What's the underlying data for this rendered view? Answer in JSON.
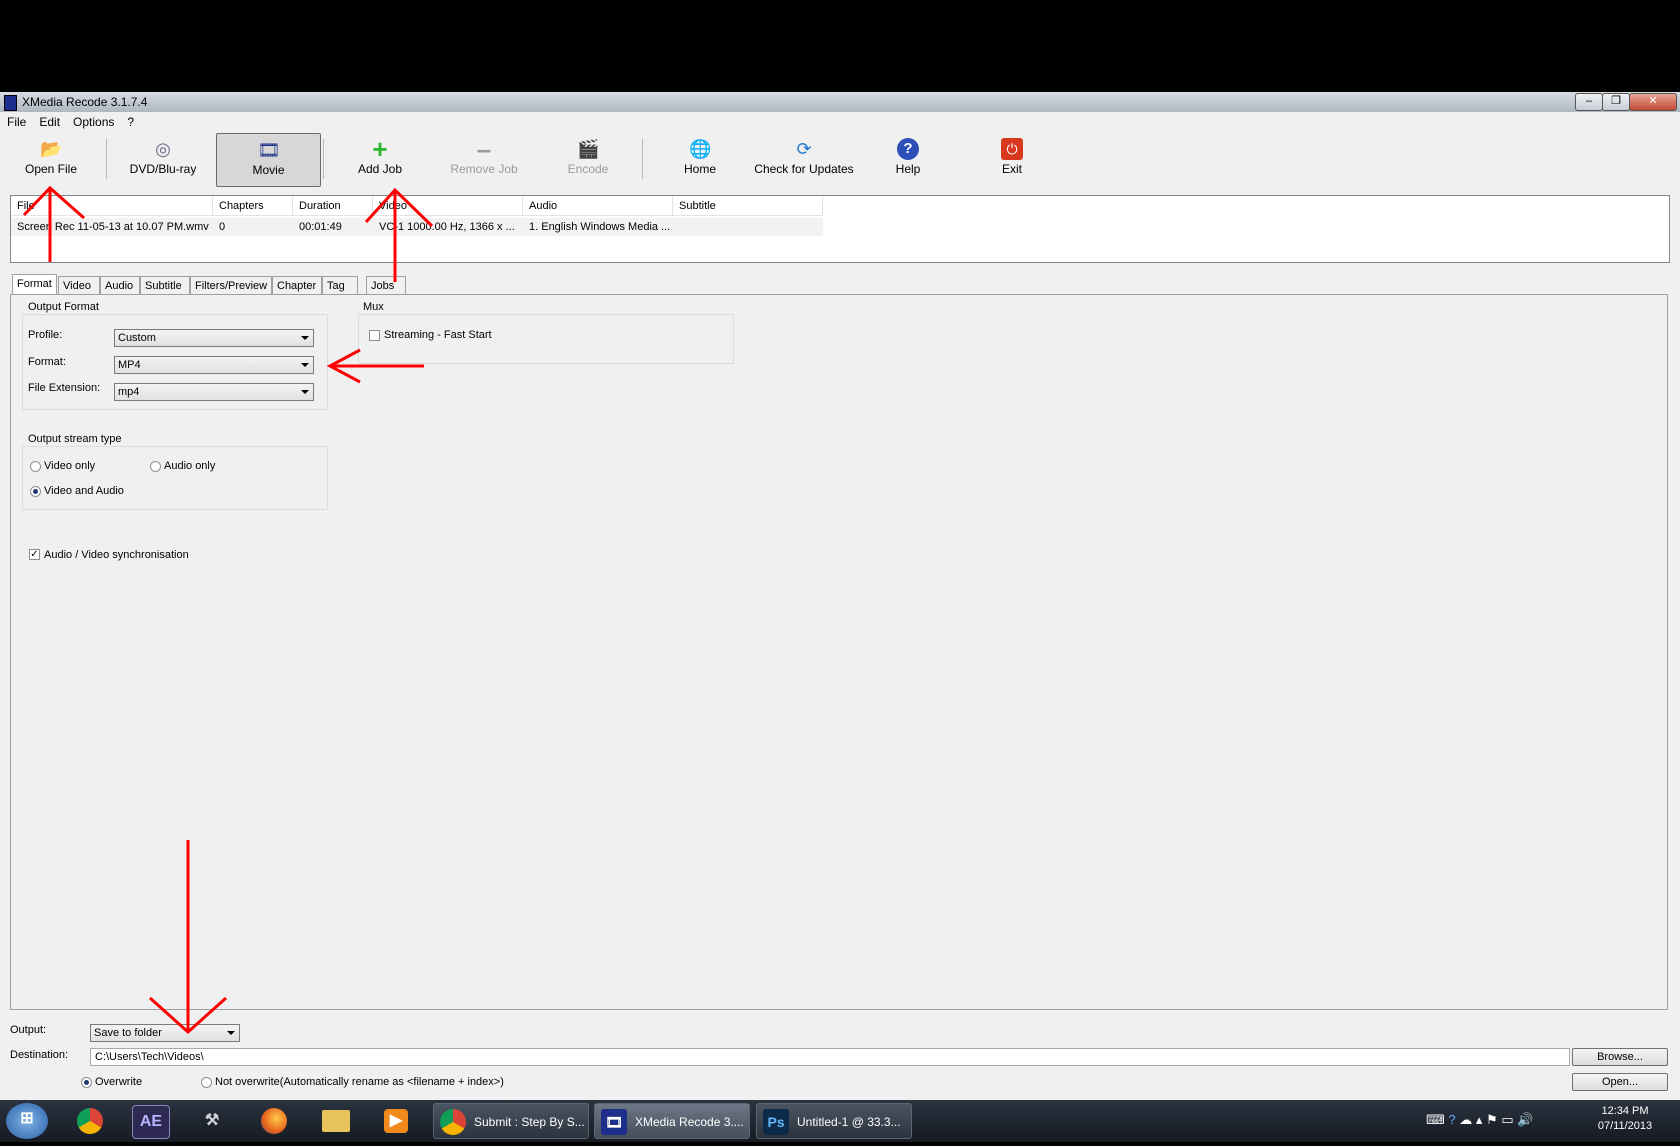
{
  "window": {
    "title": "XMedia Recode 3.1.7.4",
    "min": "0",
    "max": "1",
    "close": "r"
  },
  "menu": [
    "File",
    "Edit",
    "Options",
    "?"
  ],
  "toolbar": {
    "open_file": "Open File",
    "dvd": "DVD/Blu-ray",
    "movie": "Movie",
    "add_job": "Add Job",
    "remove_job": "Remove Job",
    "encode": "Encode",
    "home": "Home",
    "updates": "Check for Updates",
    "help": "Help",
    "exit": "Exit"
  },
  "filelist": {
    "columns": [
      "File",
      "Chapters",
      "Duration",
      "Video",
      "Audio",
      "Subtitle"
    ],
    "rows": [
      [
        "Screen Rec 11-05-13 at 10.07 PM.wmv",
        "0",
        "00:01:49",
        "VC-1 1000.00 Hz, 1366 x ...",
        "1. English Windows Media ...",
        ""
      ]
    ]
  },
  "tabs": [
    "Format",
    "Video",
    "Audio",
    "Subtitle",
    "Filters/Preview",
    "Chapter",
    "Tag",
    "Jobs"
  ],
  "format": {
    "output_format_title": "Output Format",
    "profile_label": "Profile:",
    "profile_value": "Custom",
    "format_label": "Format:",
    "format_value": "MP4",
    "ext_label": "File Extension:",
    "ext_value": "mp4",
    "mux_title": "Mux",
    "streaming_label": "Streaming - Fast Start",
    "stream_type_title": "Output stream type",
    "video_only": "Video only",
    "audio_only": "Audio only",
    "video_audio": "Video and Audio",
    "av_sync": "Audio / Video synchronisation"
  },
  "output": {
    "output_label": "Output:",
    "output_value": "Save to folder",
    "dest_label": "Destination:",
    "dest_value": "C:\\Users\\Tech\\Videos\\",
    "browse": "Browse...",
    "open": "Open...",
    "overwrite": "Overwrite",
    "not_overwrite": "Not overwrite(Automatically rename as <filename + index>)"
  },
  "taskbar": {
    "tasks": [
      "Submit : Step By S...",
      "XMedia Recode 3....",
      "Untitled-1 @ 33.3..."
    ],
    "ae": "AE",
    "ps": "Ps",
    "time": "12:34 PM",
    "date": "07/11/2013"
  },
  "colors": {
    "annotation": "#ff0000",
    "taskbar": "#1d232c",
    "window_bg": "#f0f0f0"
  },
  "icons": [
    "open-folder-icon",
    "disc-icon",
    "film-icon",
    "plus-icon",
    "minus-icon",
    "encode-icon",
    "globe-icon",
    "refresh-icon",
    "help-icon",
    "power-icon"
  ]
}
